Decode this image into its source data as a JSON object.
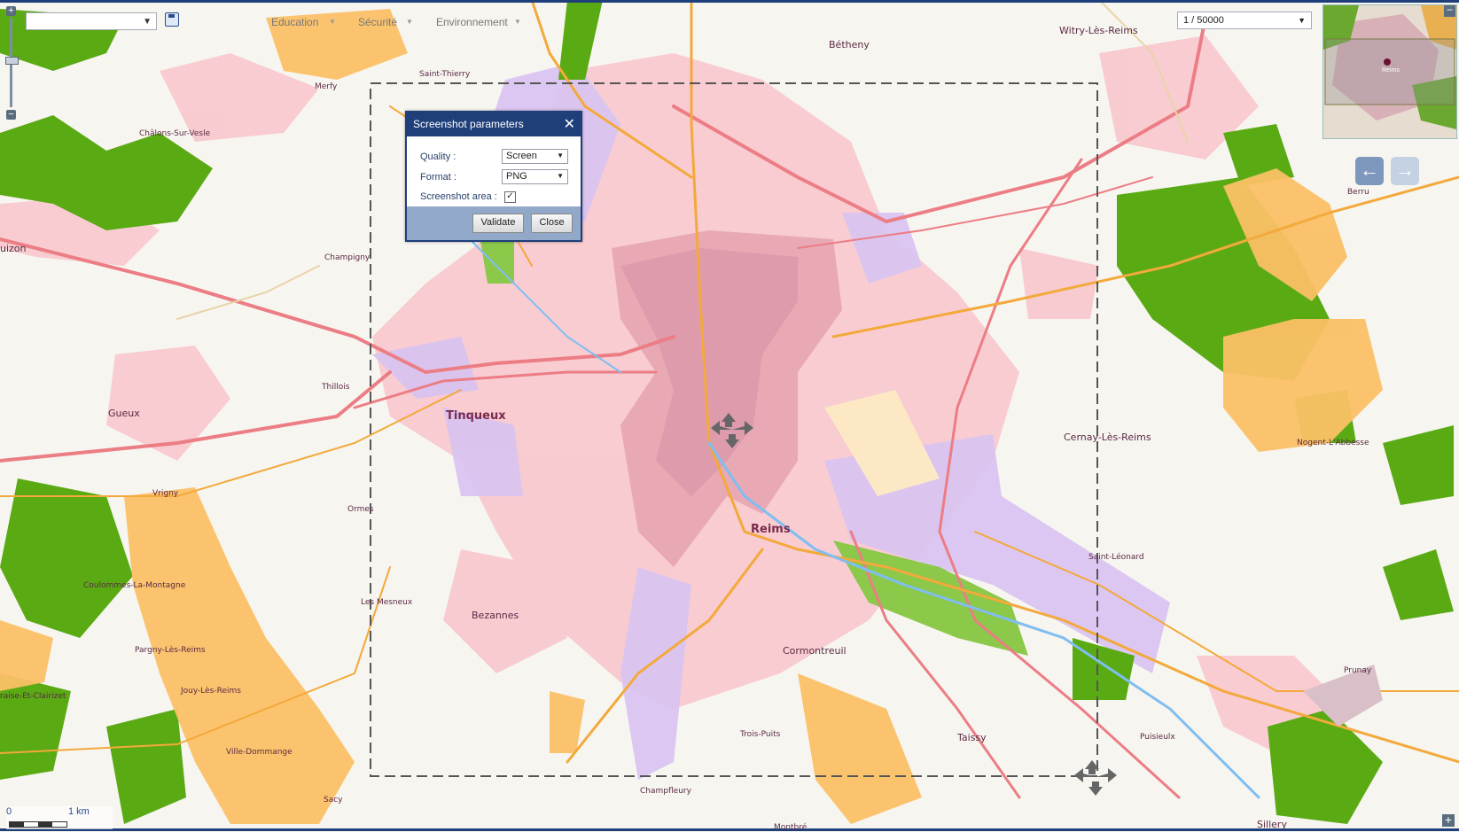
{
  "toolbar": {
    "layer_select_value": "",
    "menu": [
      {
        "label": "Education"
      },
      {
        "label": "Sécurité"
      },
      {
        "label": "Environnement"
      }
    ],
    "scale_value": "1 / 50000"
  },
  "dialog": {
    "title": "Screenshot parameters",
    "quality_label": "Quality :",
    "quality_value": "Screen",
    "format_label": "Format :",
    "format_value": "PNG",
    "area_label": "Screenshot area :",
    "area_checked": true,
    "validate_label": "Validate",
    "close_label": "Close"
  },
  "scalebar": {
    "zero": "0",
    "distance": "1 km"
  },
  "overview": {
    "label": "Reims"
  },
  "map_labels": [
    {
      "text": "Reims",
      "cls": "lbl-big"
    },
    {
      "text": "Tinqueux",
      "cls": "lbl-big"
    },
    {
      "text": "Bétheny",
      "cls": "lbl-mid"
    },
    {
      "text": "Witry-Lès-Reims",
      "cls": "lbl-mid"
    },
    {
      "text": "Cernay-Lès-Reims",
      "cls": "lbl-mid"
    },
    {
      "text": "Bezannes",
      "cls": "lbl-mid"
    },
    {
      "text": "Cormontreuil",
      "cls": "lbl-mid"
    },
    {
      "text": "Taissy",
      "cls": "lbl-mid"
    },
    {
      "text": "Gueux",
      "cls": "lbl-mid"
    },
    {
      "text": "Sillery",
      "cls": "lbl-mid"
    },
    {
      "text": "Saint-Thierry",
      "cls": "lbl-small"
    },
    {
      "text": "Merfy",
      "cls": "lbl-small"
    },
    {
      "text": "Châlons-Sur-Vesle",
      "cls": "lbl-small"
    },
    {
      "text": "Champigny",
      "cls": "lbl-small"
    },
    {
      "text": "Thillois",
      "cls": "lbl-small"
    },
    {
      "text": "Vrigny",
      "cls": "lbl-small"
    },
    {
      "text": "Ormes",
      "cls": "lbl-small"
    },
    {
      "text": "Coulommes-La-Montagne",
      "cls": "lbl-small"
    },
    {
      "text": "Pargny-Lès-Reims",
      "cls": "lbl-small"
    },
    {
      "text": "Jouy-Lès-Reims",
      "cls": "lbl-small"
    },
    {
      "text": "Ville-Dommange",
      "cls": "lbl-small"
    },
    {
      "text": "Sacy",
      "cls": "lbl-small"
    },
    {
      "text": "Les Mesneux",
      "cls": "lbl-small"
    },
    {
      "text": "Trois-Puits",
      "cls": "lbl-small"
    },
    {
      "text": "Champfleury",
      "cls": "lbl-small"
    },
    {
      "text": "Montbré",
      "cls": "lbl-small"
    },
    {
      "text": "Saint-Léonard",
      "cls": "lbl-small"
    },
    {
      "text": "Puisieulx",
      "cls": "lbl-small"
    },
    {
      "text": "Prunay",
      "cls": "lbl-small"
    },
    {
      "text": "Nogent-L'Abbesse",
      "cls": "lbl-small"
    },
    {
      "text": "Berru",
      "cls": "lbl-small"
    },
    {
      "text": "uizon",
      "cls": "lbl-mid"
    },
    {
      "text": "raise-Et-Clairizet",
      "cls": "lbl-small"
    }
  ]
}
